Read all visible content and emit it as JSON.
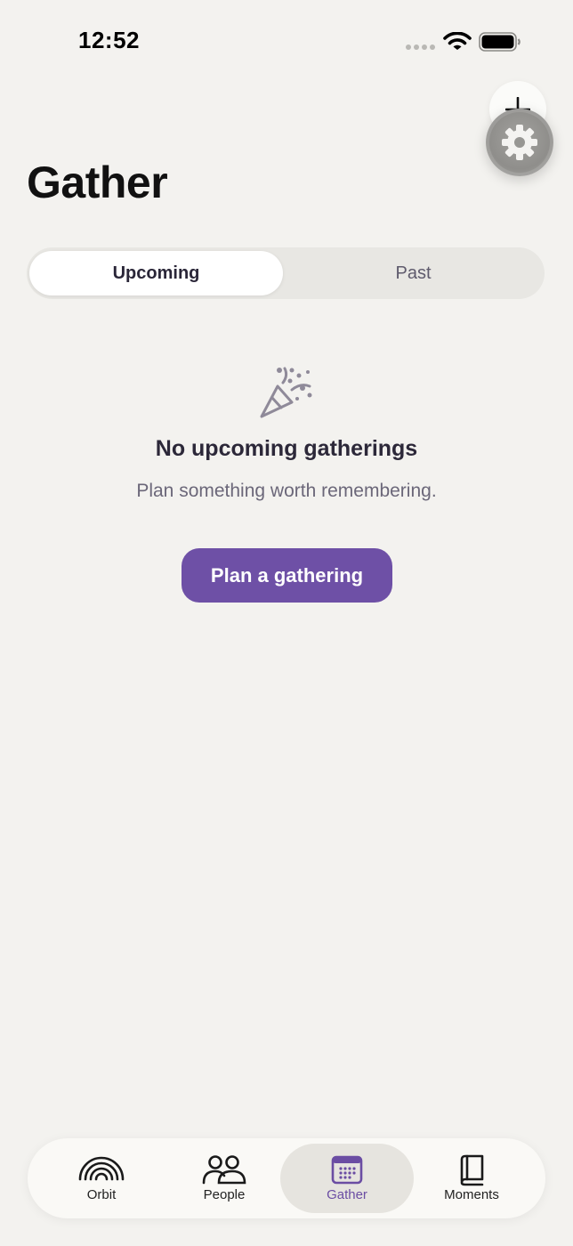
{
  "status_bar": {
    "time": "12:52"
  },
  "header": {
    "title": "Gather"
  },
  "segmented": {
    "tabs": [
      {
        "label": "Upcoming",
        "active": true
      },
      {
        "label": "Past",
        "active": false
      }
    ]
  },
  "empty_state": {
    "icon": "party-popper-icon",
    "title": "No upcoming gatherings",
    "subtitle": "Plan something worth remembering.",
    "cta_label": "Plan a gathering"
  },
  "tab_bar": {
    "items": [
      {
        "label": "Orbit",
        "icon": "rainbow-orbit-icon",
        "selected": false
      },
      {
        "label": "People",
        "icon": "people-icon",
        "selected": false
      },
      {
        "label": "Gather",
        "icon": "calendar-icon",
        "selected": true
      },
      {
        "label": "Moments",
        "icon": "book-icon",
        "selected": false
      }
    ]
  },
  "colors": {
    "accent": "#6e50a6",
    "background": "#f3f2ef",
    "tab_selected": "#6b4da3"
  }
}
